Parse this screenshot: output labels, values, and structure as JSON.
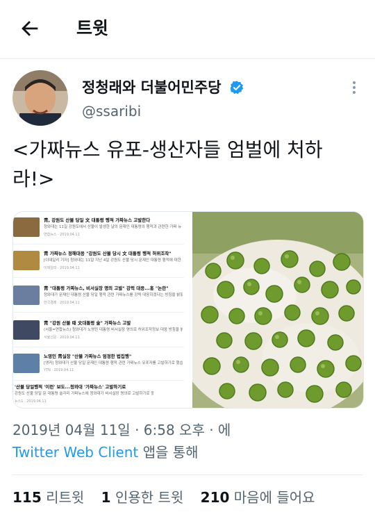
{
  "header": {
    "title": "트윗"
  },
  "author": {
    "name": "정청래와 더불어민주당",
    "handle": "@ssaribi"
  },
  "tweet": {
    "text": "<가짜뉴스 유포-생산자들 엄벌에 처하라!>"
  },
  "news_items": [
    {
      "title": "靑, 강원도 산불 당일 文 대통령 행적 가짜뉴스 고발한다",
      "snippet": "청와대는 11일 강원도에서 산불이 발생한 날의 문재인 대통령의 행적과 관련한 가짜 뉴",
      "date": "연합뉴스 · 2019.04.11",
      "thumb_color": "#8a6a3f"
    },
    {
      "title": "靑 가짜뉴스 정해대응 \"강원도 산불 당시 文 대통령 행적 허위조작\"",
      "snippet": "[이데일리 기자] 청와대는 11일 지난 4일 강원도 산불 당시 문재인 대통령 행적에 대한 가짜뉴스",
      "date": "이데일리 · 2019.04.11",
      "thumb_color": "#b08a40"
    },
    {
      "title": "靑 \"대통령 가짜뉴스, 비서실장 명의 고발\" 강력 대응...홍 \"논란\"",
      "snippet": "청와대가 문재인 대통령 산불 당일 행적 관련 가짜뉴스를 강력 대응하겠다는 방침을 밝혔다 11일",
      "date": "한국경제 · 2019.04.11",
      "thumb_color": "#6c7ea0"
    },
    {
      "title": "靑 \"강원 산불 때 文대통령 술\" 가짜뉴스 고발",
      "snippet": "(서울=연합뉴스) 청와대가 노영민 대통령 비서실장 명의로 허위조작정보 대응 방침을 밝혔다",
      "date": "서울신문 · 2019.04.11",
      "thumb_color": "#3f4a62"
    },
    {
      "title": "노영민 靑실장 \"산불 가짜뉴스 엄정한 법집행\"",
      "snippet": "[앵커] 청와대가 산불 당일 문재인 대통령 행적 관련 가짜뉴스 유포자를 고발하기로 했습니다",
      "date": "YTN · 2019.04.11",
      "thumb_color": "#5e7fa6"
    },
    {
      "title": "'산불 당일행적 '이런' 보도...청와대 '가짜뉴스' 고발하기로",
      "snippet": "강원도 산불 당일 문 대통령 술자리 가짜뉴스에 청와대가 비서실장 명의로 고발하기로 했다",
      "date": "뉴스1 · 2019.04.11",
      "thumb_color": "#ffffff"
    }
  ],
  "meta": {
    "date_time": "2019년 04월 11일 · 6:58 오후 · 에",
    "client": "Twitter Web Client",
    "via": "앱을 통해"
  },
  "stats": {
    "retweets": "115",
    "retweets_label": "리트윗",
    "quotes": "1",
    "quotes_label": "인용한 트윗",
    "likes": "210",
    "likes_label": "마음에 들어요"
  },
  "colors": {
    "accent": "#1d9bf0",
    "verified": "#1d9bf0",
    "text": "#0f1419",
    "secondary": "#536471"
  }
}
